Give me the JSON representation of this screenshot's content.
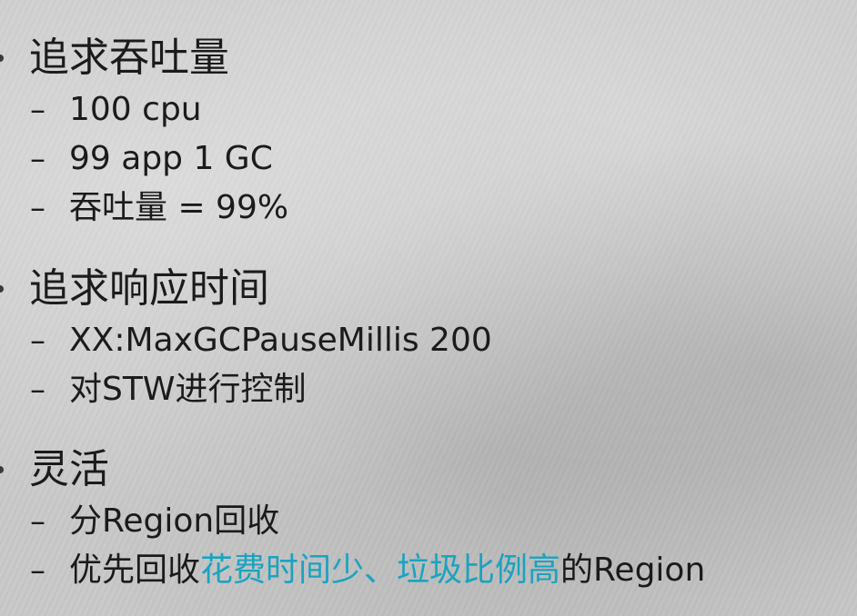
{
  "sections": [
    {
      "title": "追求吞吐量",
      "items": [
        "100 cpu",
        "99 app 1 GC",
        "吞吐量 = 99%"
      ]
    },
    {
      "title": "追求响应时间",
      "items": [
        "XX:MaxGCPauseMillis 200",
        "对STW进行控制"
      ]
    },
    {
      "title": "灵活",
      "items": [
        "分Region回收"
      ],
      "last_item": {
        "prefix": "优先回收",
        "highlight": "花费时间少、垃圾比例高",
        "suffix": "的Region"
      }
    }
  ],
  "dash_symbol": "–",
  "colors": {
    "text": "#1b1b1b",
    "highlight": "#1aa3c0"
  }
}
